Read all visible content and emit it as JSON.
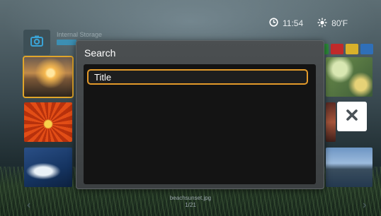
{
  "status": {
    "time": "11:54",
    "temperature": "80'F"
  },
  "location": {
    "title": "Internal Storage"
  },
  "color_keys": [
    "#2e8e3b",
    "#c02a2a",
    "#d8b12a",
    "#2f6fb8"
  ],
  "accent": "#e39a2a",
  "dialog": {
    "title": "Search",
    "options": [
      {
        "label": "Title",
        "selected": true
      }
    ]
  },
  "viewer": {
    "filename": "beachsunset.jpg",
    "position": "1/21"
  }
}
